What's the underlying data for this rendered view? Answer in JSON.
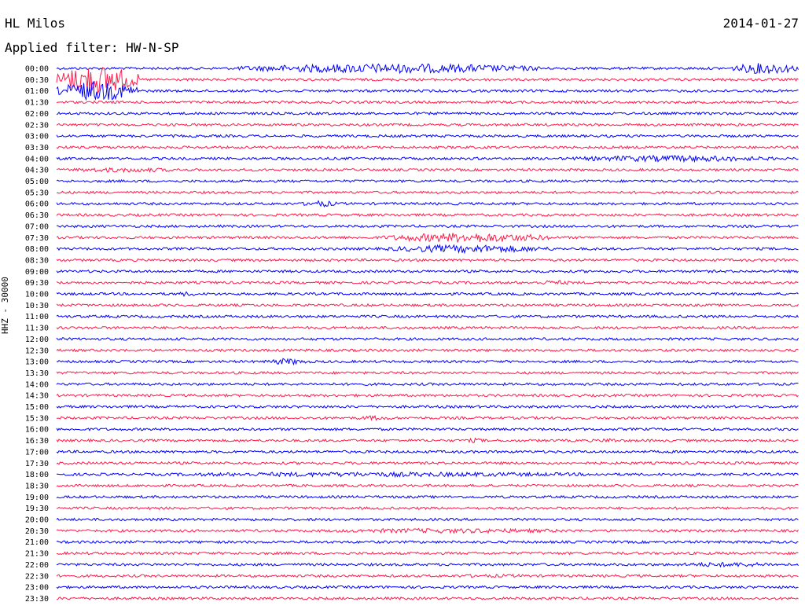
{
  "header": {
    "station": "HL Milos",
    "date": "2014-01-27",
    "filter": "Applied filter: HW-N-SP"
  },
  "chart_data": {
    "type": "line",
    "title": "HL Milos",
    "date": "2014-01-27",
    "channel_label": "HHZ - 30000",
    "colors": [
      "#0000ff",
      "#ff1a4b"
    ],
    "tick_labels": [
      "00:00",
      "00:30",
      "01:00",
      "01:30",
      "02:00",
      "02:30",
      "03:00",
      "03:30",
      "04:00",
      "04:30",
      "05:00",
      "05:30",
      "06:00",
      "06:30",
      "07:00",
      "07:30",
      "08:00",
      "08:30",
      "09:00",
      "09:30",
      "10:00",
      "10:30",
      "11:00",
      "11:30",
      "12:00",
      "12:30",
      "13:00",
      "13:30",
      "14:00",
      "14:30",
      "15:00",
      "15:30",
      "16:00",
      "16:30",
      "17:00",
      "17:30",
      "18:00",
      "18:30",
      "19:00",
      "19:30",
      "20:00",
      "20:30",
      "21:00",
      "21:30",
      "22:00",
      "22:30",
      "23:00",
      "23:30"
    ],
    "events": [
      {
        "trace": "00:30",
        "t": 0.0,
        "w": 0.11,
        "amp": 18
      },
      {
        "trace": "01:00",
        "t": 0.0,
        "w": 0.11,
        "amp": 12
      },
      {
        "trace": "00:00",
        "t": 0.24,
        "w": 0.42,
        "amp": 6
      },
      {
        "trace": "00:00",
        "t": 0.91,
        "w": 0.09,
        "amp": 7
      },
      {
        "trace": "04:00",
        "t": 0.68,
        "w": 0.3,
        "amp": 4
      },
      {
        "trace": "04:30",
        "t": 0.0,
        "w": 0.18,
        "amp": 3
      },
      {
        "trace": "06:00",
        "t": 0.33,
        "w": 0.05,
        "amp": 4
      },
      {
        "trace": "07:30",
        "t": 0.44,
        "w": 0.23,
        "amp": 6
      },
      {
        "trace": "08:00",
        "t": 0.44,
        "w": 0.23,
        "amp": 5
      },
      {
        "trace": "09:30",
        "t": 0.64,
        "w": 0.06,
        "amp": 3
      },
      {
        "trace": "10:00",
        "t": 0.16,
        "w": 0.03,
        "amp": 3
      },
      {
        "trace": "13:00",
        "t": 0.28,
        "w": 0.06,
        "amp": 4
      },
      {
        "trace": "15:30",
        "t": 0.4,
        "w": 0.06,
        "amp": 3
      },
      {
        "trace": "16:30",
        "t": 0.55,
        "w": 0.03,
        "amp": 3
      },
      {
        "trace": "16:30",
        "t": 0.73,
        "w": 0.03,
        "amp": 3
      },
      {
        "trace": "18:00",
        "t": 0.08,
        "w": 0.72,
        "amp": 3
      },
      {
        "trace": "20:30",
        "t": 0.33,
        "w": 0.4,
        "amp": 3
      },
      {
        "trace": "22:00",
        "t": 0.82,
        "w": 0.17,
        "amp": 3
      },
      {
        "trace": "22:30",
        "t": 0.47,
        "w": 0.23,
        "amp": 2
      }
    ]
  }
}
